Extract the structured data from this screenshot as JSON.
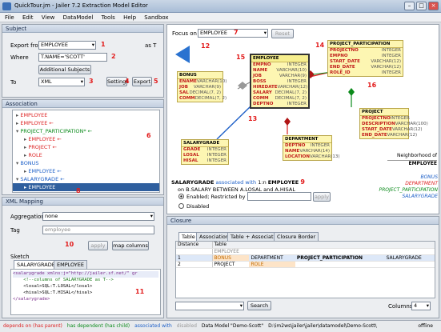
{
  "window": {
    "title": "QuickTour.jm - Jailer 7.2 Extraction Model Editor"
  },
  "menu": [
    "File",
    "Edit",
    "View",
    "DataModel",
    "Tools",
    "Help",
    "Sandbox"
  ],
  "subject": {
    "section": "Subject",
    "export_from_label": "Export from",
    "export_from_value": "EMPLOYEE",
    "as_t": "as T",
    "where_label": "Where",
    "where_value": "T.NAME='SCOTT'",
    "additional_subjects": "Additional Subjects",
    "to_label": "To",
    "to_value": "XML",
    "settings": "Settings",
    "export": "Export"
  },
  "association": {
    "section": "Association",
    "items": [
      {
        "text": "EMPLOYEE",
        "color": "#d22",
        "indent": 0,
        "mark": "▸"
      },
      {
        "text": "EMPLOYEE",
        "color": "#d22",
        "indent": 0,
        "mark": "▸",
        "arrow": "←"
      },
      {
        "text": "PROJECT_PARTICIPATION*",
        "color": "#0a8a1a",
        "indent": 0,
        "mark": "▾",
        "arrow": "←"
      },
      {
        "text": "EMPLOYEE",
        "color": "#d22",
        "indent": 1,
        "mark": "▸",
        "arrow": "←"
      },
      {
        "text": "PROJECT",
        "color": "#d22",
        "indent": 1,
        "mark": "▸",
        "arrow": "←"
      },
      {
        "text": "ROLE",
        "color": "#d22",
        "indent": 1,
        "mark": "▸"
      },
      {
        "text": "BONUS",
        "color": "#1e60c8",
        "indent": 0,
        "mark": "▾"
      },
      {
        "text": "EMPLOYEE",
        "color": "#1e60c8",
        "indent": 1,
        "mark": "▸",
        "arrow": "←"
      },
      {
        "text": "SALARYGRADE",
        "color": "#1e60c8",
        "indent": 0,
        "mark": "▾",
        "arrow": "←"
      },
      {
        "text": "EMPLOYEE",
        "color": "#ffffff",
        "indent": 1,
        "mark": "▸",
        "selected": true
      }
    ]
  },
  "xml": {
    "section": "XML Mapping",
    "aggregation_label": "Aggregation",
    "aggregation_value": "none",
    "tag_label": "Tag",
    "tag_value": "employee",
    "apply": "apply",
    "map_columns": "map columns",
    "sketch_label": "Sketch",
    "sketch_tabs": [
      "SALARYGRADE",
      "EMPLOYEE"
    ],
    "sketch_lines": [
      "<salarygrade xmlns:j=\"http://jailer.sf.net/\" gr",
      "    <!--columns of SALARYGRADE as T-->",
      "    <losal>SQL:T.LOSAL</losal>",
      "    <hisal>SQL:T.HISAL</hisal>",
      "</salarygrade>"
    ]
  },
  "focus": {
    "label": "Focus on",
    "value": "EMPLOYEE",
    "reset": "Reset"
  },
  "graph": {
    "employee": {
      "title": "EMPLOYEE",
      "rows": [
        [
          "EMPNO",
          "INTEGER"
        ],
        [
          "NAME",
          "VARCHAR(10)"
        ],
        [
          "JOB",
          "VARCHAR(9)"
        ],
        [
          "BOSS",
          "INTEGER"
        ],
        [
          "HIREDATE",
          "VARCHAR(12)"
        ],
        [
          "SALARY",
          "DECIMAL(7, 2)"
        ],
        [
          "COMM",
          "DECIMAL(7, 2)"
        ],
        [
          "DEPTNO",
          "INTEGER"
        ]
      ]
    },
    "bonus": {
      "title": "BONUS",
      "rows": [
        [
          "ENAME",
          "VARCHAR(10)"
        ],
        [
          "JOB",
          "VARCHAR(9)"
        ],
        [
          "SAL",
          "DECIMAL(7, 2)"
        ],
        [
          "COMM",
          "DECIMAL(7, 2)"
        ]
      ]
    },
    "pp": {
      "title": "PROJECT_PARTICIPATION",
      "rows": [
        [
          "PROJECTNO",
          "INTEGER"
        ],
        [
          "EMPNO",
          "INTEGER"
        ],
        [
          "START_DATE",
          "VARCHAR(12)"
        ],
        [
          "END_DATE",
          "VARCHAR(12)"
        ],
        [
          "ROLE_ID",
          "INTEGER"
        ]
      ]
    },
    "project": {
      "title": "PROJECT",
      "rows": [
        [
          "PROJECTNO",
          "INTEGER"
        ],
        [
          "DESCRIPTION",
          "VARCHAR(100)"
        ],
        [
          "START_DATE",
          "VARCHAR(12)"
        ],
        [
          "END_DATE",
          "VARCHAR(12)"
        ]
      ]
    },
    "salarygrade": {
      "title": "SALARYGRADE",
      "rows": [
        [
          "GRADE",
          "INTEGER"
        ],
        [
          "LOSAL",
          "INTEGER"
        ],
        [
          "HISAL",
          "INTEGER"
        ]
      ]
    },
    "department": {
      "title": "DEPARTMENT",
      "rows": [
        [
          "DEPTNO",
          "INTEGER"
        ],
        [
          "NAME",
          "VARCHAR(14)"
        ],
        [
          "LOCATION",
          "VARCHAR(13)"
        ]
      ]
    },
    "neighborhood": {
      "title": "Neighborhood of",
      "name": "EMPLOYEE"
    },
    "legend": [
      {
        "text": "BONUS",
        "color": "#1e60c8"
      },
      {
        "text": "DEPARTMENT",
        "color": "#d22"
      },
      {
        "text": "PROJECT_PARTICIPATION",
        "color": "#0a8a1a"
      },
      {
        "text": "SALARYGRADE",
        "color": "#1e60c8"
      }
    ]
  },
  "assoc_detail": {
    "from": "SALARYGRADE",
    "assoc": "associated with",
    "card": "1:n",
    "to": "EMPLOYEE",
    "cond": "on B.SALARY BETWEEN A.LOSAL and A.HISAL",
    "enabled": "Enabled; Restricted by",
    "apply": "apply",
    "disabled": "Disabled"
  },
  "closure": {
    "section": "Closure",
    "tabs": [
      "Table",
      "Association",
      "Table + Association",
      "Closure Border"
    ],
    "col_distance": "Distance",
    "col_table": "Table",
    "rows": [
      [
        "",
        "EMPLOYEE",
        "",
        "",
        ""
      ],
      [
        "1",
        "BONUS",
        "DEPARTMENT",
        "PROJECT_PARTICIPATION",
        "SALARYGRADE"
      ],
      [
        "2",
        "PROJECT",
        "ROLE",
        "",
        ""
      ]
    ],
    "search": "Search",
    "columns_label": "Columns",
    "columns_value": "4"
  },
  "status": {
    "depends_on": "depends on (has parent)",
    "has_dependent": "has dependent (has child)",
    "associated_with": "associated with",
    "disabled": "disabled",
    "model": "Data Model \"Demo-Scott\"",
    "path": "D:\\im2ws\\jailer\\jailer\\datamodel\\Demo-Scott\\",
    "offline": "offline"
  },
  "callouts": [
    "1",
    "2",
    "3",
    "4",
    "5",
    "6",
    "7",
    "8",
    "9",
    "10",
    "11",
    "12",
    "13",
    "14",
    "15",
    "16"
  ],
  "colors": {
    "accent_red": "#e21b1b",
    "association_blue": "#1e60c8",
    "dependency_green": "#0a8a1a"
  }
}
